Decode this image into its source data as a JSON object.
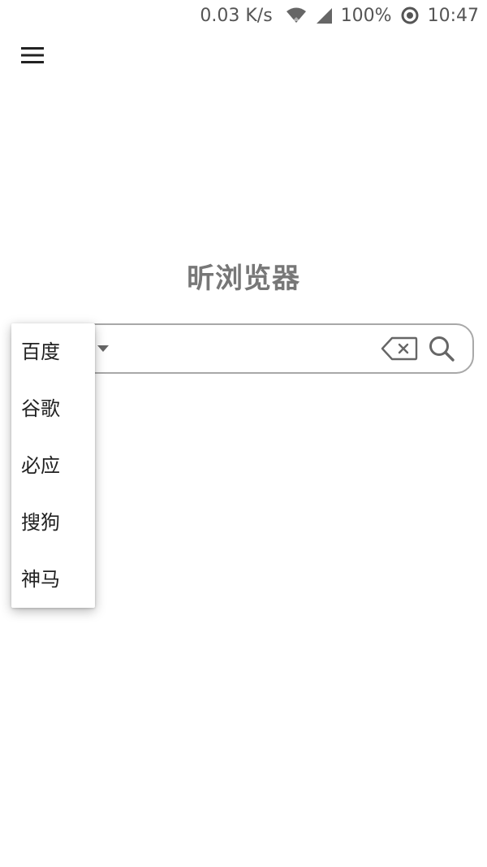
{
  "status_bar": {
    "net_speed": "0.03 K/s",
    "battery": "100%",
    "time": "10:47",
    "icons": [
      "wifi-icon",
      "signal-icon",
      "sync-icon"
    ]
  },
  "header": {
    "menu_icon": "hamburger-menu-icon"
  },
  "main": {
    "title": "昕浏览器"
  },
  "search": {
    "placeholder": "",
    "value": "",
    "clear_icon": "backspace-clear-icon",
    "search_icon": "search-icon"
  },
  "engine_menu": {
    "options": [
      {
        "label": "百度"
      },
      {
        "label": "谷歌"
      },
      {
        "label": "必应"
      },
      {
        "label": "搜狗"
      },
      {
        "label": "神马"
      }
    ]
  },
  "colors": {
    "title": "#777777",
    "border": "#a8a8a8",
    "icon": "#666666"
  }
}
